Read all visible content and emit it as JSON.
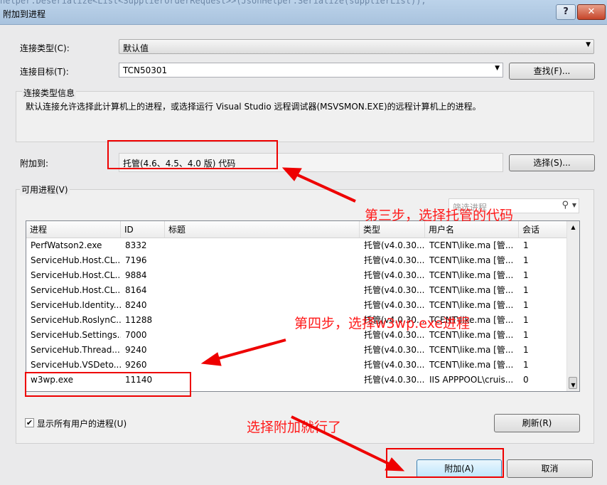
{
  "window": {
    "title": "附加到进程",
    "background_code": "helper.Deserialize<List<SupplierOrderRequest>>(JsonHelper.Serialize(supplierList));",
    "help_label": "?",
    "close_label": "✕"
  },
  "connection": {
    "type_label": "连接类型(C):",
    "type_value": "默认值",
    "target_label": "连接目标(T):",
    "target_value": "TCN50301",
    "find_button": "查找(F)...",
    "info_title": "连接类型信息",
    "info_text": "默认连接允许选择此计算机上的进程，或选择运行 Visual Studio 远程调试器(MSVSMON.EXE)的远程计算机上的进程。"
  },
  "attach": {
    "label": "附加到:",
    "value": "托管(4.6、4.5、4.0 版) 代码",
    "select_button": "选择(S)..."
  },
  "processes": {
    "group_label": "可用进程(V)",
    "filter_placeholder": "筛选进程",
    "columns": [
      "进程",
      "ID",
      "标题",
      "类型",
      "用户名",
      "会话"
    ],
    "rows": [
      [
        "PerfWatson2.exe",
        "8332",
        "",
        "托管(v4.0.30...",
        "TCENT\\like.ma [管...",
        "1"
      ],
      [
        "ServiceHub.Host.CL...",
        "7196",
        "",
        "托管(v4.0.30...",
        "TCENT\\like.ma [管...",
        "1"
      ],
      [
        "ServiceHub.Host.CL...",
        "9884",
        "",
        "托管(v4.0.30...",
        "TCENT\\like.ma [管...",
        "1"
      ],
      [
        "ServiceHub.Host.CL...",
        "8164",
        "",
        "托管(v4.0.30...",
        "TCENT\\like.ma [管...",
        "1"
      ],
      [
        "ServiceHub.Identity...",
        "8240",
        "",
        "托管(v4.0.30...",
        "TCENT\\like.ma [管...",
        "1"
      ],
      [
        "ServiceHub.RoslynC...",
        "11288",
        "",
        "托管(v4.0.30...",
        "TCENT\\like.ma [管...",
        "1"
      ],
      [
        "ServiceHub.Settings...",
        "7000",
        "",
        "托管(v4.0.30...",
        "TCENT\\like.ma [管...",
        "1"
      ],
      [
        "ServiceHub.Thread...",
        "9240",
        "",
        "托管(v4.0.30...",
        "TCENT\\like.ma [管...",
        "1"
      ],
      [
        "ServiceHub.VSDeto...",
        "9260",
        "",
        "托管(v4.0.30...",
        "TCENT\\like.ma [管...",
        "1"
      ],
      [
        "w3wp.exe",
        "11140",
        "",
        "托管(v4.0.30...",
        "IIS APPPOOL\\cruis...",
        "0"
      ]
    ],
    "show_all_users_label": "显示所有用户的进程(U)",
    "show_all_users_checked": true,
    "refresh_button": "刷新(R)"
  },
  "footer": {
    "attach_button": "附加(A)",
    "cancel_button": "取消"
  },
  "annotations": {
    "step3": "第三步，选择托管的代码",
    "step4": "第四步，选择w3wp.exe进程",
    "step5": "选择附加就行了",
    "color": "#ff1a1a"
  }
}
